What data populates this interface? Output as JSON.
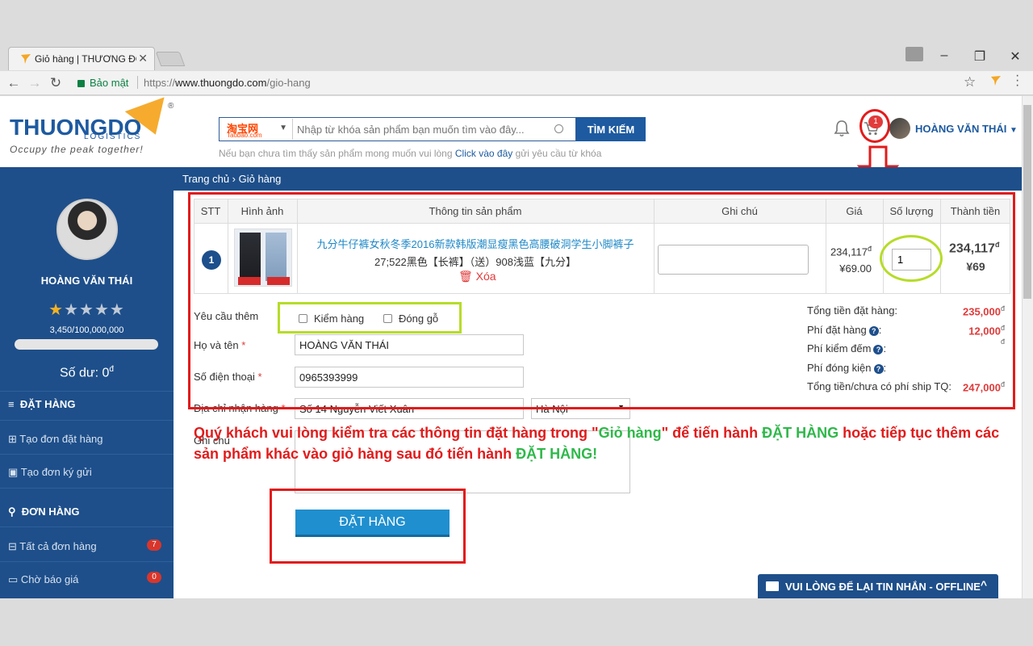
{
  "browser": {
    "tab_title": "Giỏ hàng | THƯƠNG ĐÔ",
    "tab_close": "✕",
    "secure_label": "Bảo mật",
    "url_scheme": "https://",
    "url_host": "www.thuongdo.com",
    "url_path": "/gio-hang"
  },
  "header": {
    "logo_text": "THUONGDO",
    "logo_sub": "LOGISTICS",
    "logo_reg": "®",
    "tagline": "Occupy the peak together!",
    "search_source_main": "淘宝网",
    "search_source_sub": "Taobao.com",
    "search_placeholder": "Nhập từ khóa sản phẩm bạn muốn tìm vào đây...",
    "search_button": "TÌM KIẾM",
    "search_hint_before": "Nếu bạn chưa tìm thấy sản phẩm mong muốn vui lòng ",
    "search_hint_link": "Click vào đây",
    "search_hint_after": " gửi yêu cầu từ khóa",
    "cart_count": "1",
    "user_name": "HOÀNG VĂN THÁI"
  },
  "breadcrumb": "Trang chủ  ›  Giỏ hàng",
  "sidebar": {
    "user_name": "HOÀNG VĂN THÁI",
    "rating": 1,
    "rating_max": 5,
    "points": "3,450/100,000,000",
    "progress": 3.45e-05,
    "balance_label": "Số dư: 0",
    "balance_unit": "đ",
    "sections": [
      {
        "title": "ĐẶT HÀNG",
        "items": [
          {
            "label": "Tạo đơn đặt hàng"
          },
          {
            "label": "Tạo đơn ký gửi"
          }
        ]
      },
      {
        "title": "ĐƠN HÀNG",
        "items": [
          {
            "label": "Tất cả đơn hàng",
            "badge": "7"
          },
          {
            "label": "Chờ báo giá",
            "badge": "0"
          }
        ]
      }
    ]
  },
  "cart": {
    "columns": [
      "STT",
      "Hình ảnh",
      "Thông tin sản phẩm",
      "Ghi chú",
      "Giá",
      "Số lượng",
      "Thành tiền"
    ],
    "rows": [
      {
        "index": "1",
        "title": "九分牛仔裤女秋冬季2016新款韩版潮显瘦黑色高腰破洞学生小脚裤子",
        "attributes": "27;522黑色【长裤】（送）908浅蓝【九分】",
        "delete_label": "Xóa",
        "note": "",
        "price_vnd": "234,117",
        "price_cny": "¥69.00",
        "quantity": "1",
        "total_vnd": "234,117",
        "total_cny": "¥69",
        "currency_unit": "đ"
      }
    ]
  },
  "form": {
    "extra_label": "Yêu cầu thêm",
    "option_inspect": "Kiểm hàng",
    "option_wood": "Đóng gỗ",
    "name_label": "Họ và tên",
    "name_value": "HOÀNG VĂN THÁI",
    "phone_label": "Số điện thoại",
    "phone_value": "0965393999",
    "address_label": "Địa chỉ nhận hàng",
    "address_value": "Số 14 Nguyễn Viết Xuân",
    "city_value": "Hà Nội",
    "note_label": "Ghi chú",
    "required_mark": "*"
  },
  "summary": {
    "order_total_label": "Tổng tiền đặt hàng:",
    "order_total_value": "235,000",
    "order_fee_label": "Phí đặt hàng",
    "order_fee_value": "12,000",
    "check_fee_label": "Phí kiểm đếm",
    "check_fee_value": "",
    "pack_fee_label": "Phí đóng kiện",
    "grand_total_label": "Tổng tiền/chưa có phí ship TQ:",
    "grand_total_value": "247,000",
    "currency_unit": "đ"
  },
  "notice": {
    "part1": "Quý khách vui lòng kiểm tra các thông tin đặt hàng trong \"",
    "part2": "Giỏ hàng",
    "part3": "\" để tiến hành ",
    "part4": "ĐẶT HÀNG",
    "part5": " hoặc tiếp tục thêm các sản phẩm khác vào giỏ hàng sau đó tiến hành ",
    "part6": "ĐẶT HÀNG!"
  },
  "order_button": "ĐẶT HÀNG",
  "chat": {
    "label": "VUI LÒNG ĐỂ LẠI TIN NHẮN - OFFLINE",
    "chevron": "^"
  },
  "colors": {
    "brand_blue": "#1e4f8a",
    "accent_orange": "#f5a623",
    "button_blue": "#1f8fcf",
    "highlight_red": "#e21b1b",
    "highlight_green": "#b6dc28"
  }
}
